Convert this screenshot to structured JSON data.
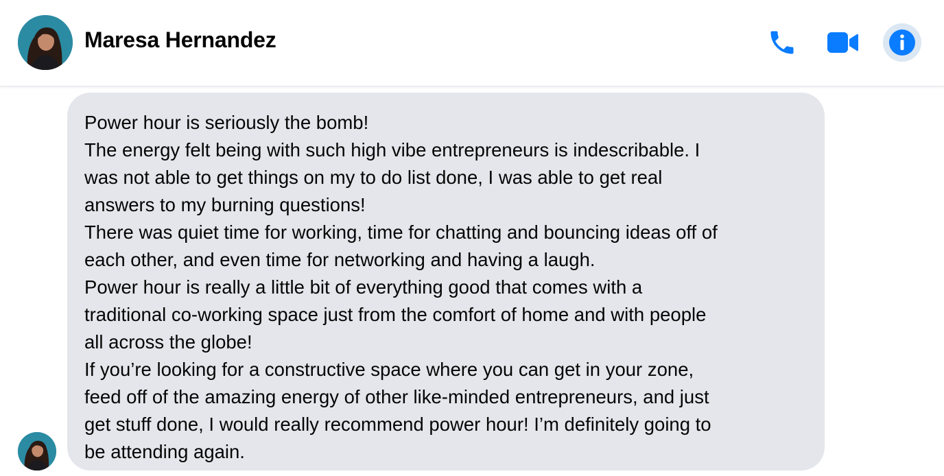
{
  "header": {
    "contact_name": "Maresa Hernandez",
    "actions": [
      {
        "name": "call-button",
        "icon": "phone-icon"
      },
      {
        "name": "video-call-button",
        "icon": "video-camera-icon"
      },
      {
        "name": "info-button",
        "icon": "info-icon"
      }
    ]
  },
  "colors": {
    "accent": "#0a7cff",
    "bubble_bg": "#e4e6eb",
    "info_button_bg": "#dbe7f2"
  },
  "message": {
    "lines": [
      "Power hour is seriously the bomb!",
      "The energy felt being with such high vibe entrepreneurs is indescribable. I",
      "was not able to get things on my to do list done, I was able to get real",
      "answers to my burning questions!",
      "There was quiet time for working, time for chatting and bouncing ideas off of",
      "each other, and even time for networking and having a laugh.",
      "Power hour is really a little bit of everything good that comes with a",
      "traditional co-working space just from the comfort of home and with people",
      "all across the globe!",
      "If you’re looking for a constructive space where you can get in your zone,",
      "feed off of the amazing energy of other like-minded entrepreneurs, and just",
      "get stuff done, I would really recommend power hour! I’m definitely going to",
      "be attending again."
    ]
  }
}
